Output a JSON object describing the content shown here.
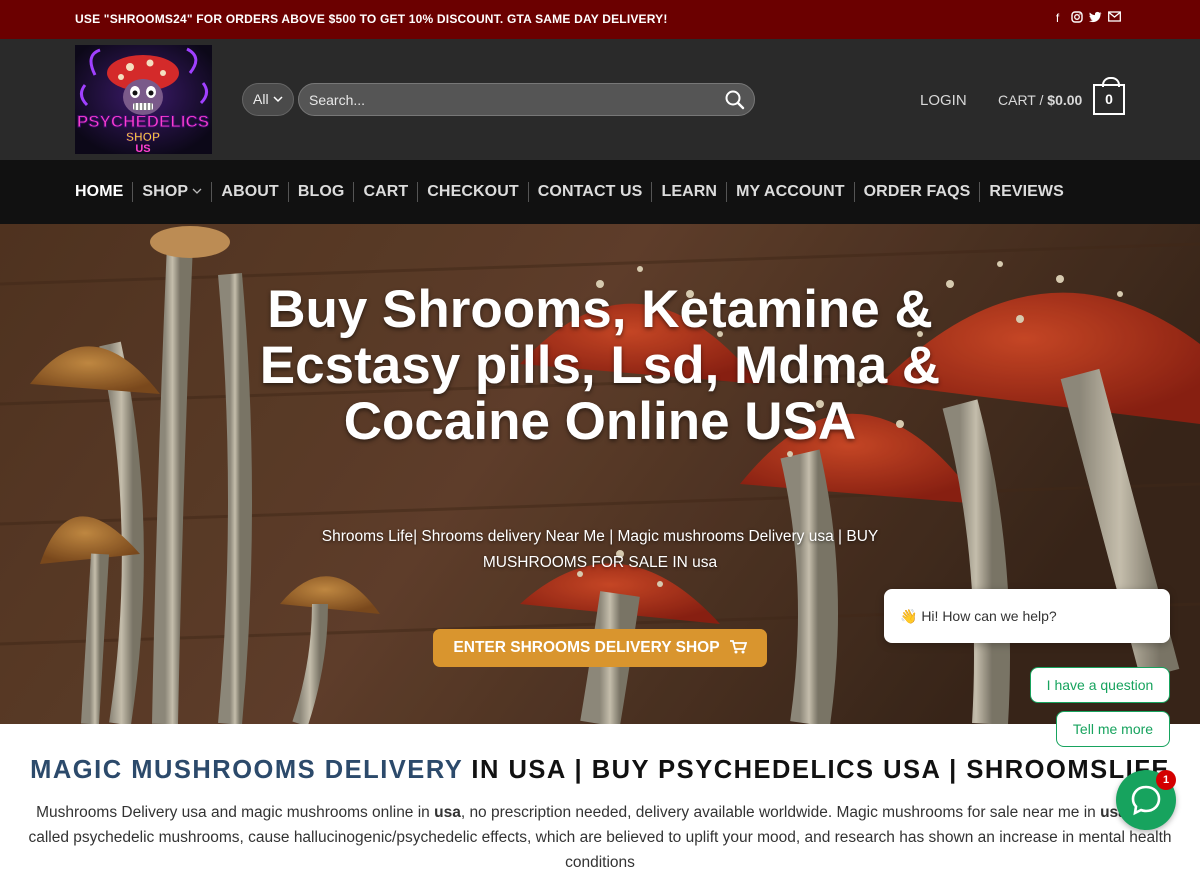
{
  "topbar": {
    "promo": "USE \"SHROOMS24\" FOR ORDERS ABOVE $500 TO GET 10% DISCOUNT. GTA SAME DAY DELIVERY!",
    "social_icons": [
      "facebook-icon",
      "instagram-icon",
      "twitter-icon",
      "email-icon"
    ]
  },
  "header": {
    "logo_lines": [
      "PSYCHEDELICS",
      "SHOP",
      "US"
    ],
    "search_category": "All",
    "search_placeholder": "Search...",
    "login_label": "LOGIN",
    "cart_label": "CART /",
    "cart_total": "$0.00",
    "cart_count": "0"
  },
  "nav": {
    "items": [
      {
        "label": "HOME",
        "active": true
      },
      {
        "label": "SHOP",
        "dropdown": true
      },
      {
        "label": "ABOUT"
      },
      {
        "label": "BLOG"
      },
      {
        "label": "CART"
      },
      {
        "label": "CHECKOUT"
      },
      {
        "label": "CONTACT US"
      },
      {
        "label": "LEARN"
      },
      {
        "label": "MY ACCOUNT"
      },
      {
        "label": "ORDER FAQS"
      },
      {
        "label": "REVIEWS"
      }
    ]
  },
  "hero": {
    "title": "Buy Shrooms, Ketamine & Ecstasy pills, Lsd, Mdma & Cocaine Online USA",
    "subtitle": "Shrooms Life| Shrooms delivery Near Me | Magic mushrooms Delivery usa | BUY MUSHROOMS FOR SALE IN usa",
    "button_label": "ENTER SHROOMS DELIVERY SHOP"
  },
  "chat": {
    "greeting": "👋 Hi! How can we help?",
    "option1": "I have a question",
    "option2": "Tell me more",
    "badge": "1"
  },
  "section": {
    "title_blue": "MAGIC MUSHROOMS DELIVERY",
    "title_rest": " IN USA | BUY PSYCHEDELICS USA | SHROOMSLIFE",
    "body_part1": "Mushrooms Delivery usa and magic mushrooms online in ",
    "body_bold1": "usa",
    "body_part2": ", no prescription needed, delivery available worldwide. Magic mushrooms for sale near me in ",
    "body_bold2": "usa",
    "body_part3": ", also called psychedelic mushrooms, cause hallucinogenic/psychedelic effects, which are believed to uplift your mood, and research has shown an increase in mental health conditions"
  },
  "colors": {
    "topbar": "#6b0000",
    "header": "#2a2a2a",
    "nav": "#111111",
    "accent_button": "#d9952e",
    "chat_green": "#17a35e",
    "title_blue": "#2c4a6b"
  }
}
